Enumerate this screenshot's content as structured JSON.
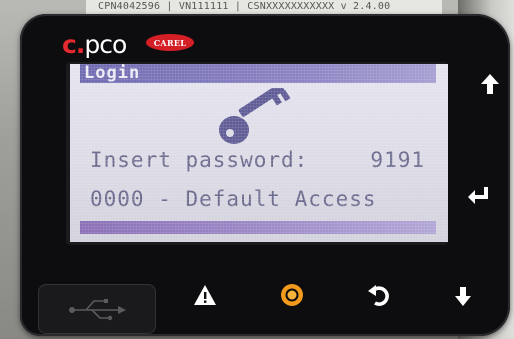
{
  "device": {
    "sticker_text": "CPN4042596 | VN111111 | CSNXXXXXXXXXXX v 2.4.00",
    "brand_c": "c.",
    "brand_pco": "pco",
    "carel_badge": "CAREL"
  },
  "screen": {
    "title": "Login",
    "password_label": "Insert password:",
    "password_value": "9191",
    "hint": "0000 - Default Access",
    "icon": "key-icon"
  },
  "buttons": {
    "up": "up-arrow-icon",
    "enter": "enter-icon",
    "down": "down-arrow-icon",
    "alarm": "alarm-triangle-icon",
    "program": "program-circle-icon",
    "escape": "escape-icon",
    "usb": "usb-icon"
  },
  "colors": {
    "lcd_text": "#6b6a8d",
    "title_bar": "#7b74b8",
    "program_button": "#f39a1c",
    "brand_red": "#e4292f"
  }
}
